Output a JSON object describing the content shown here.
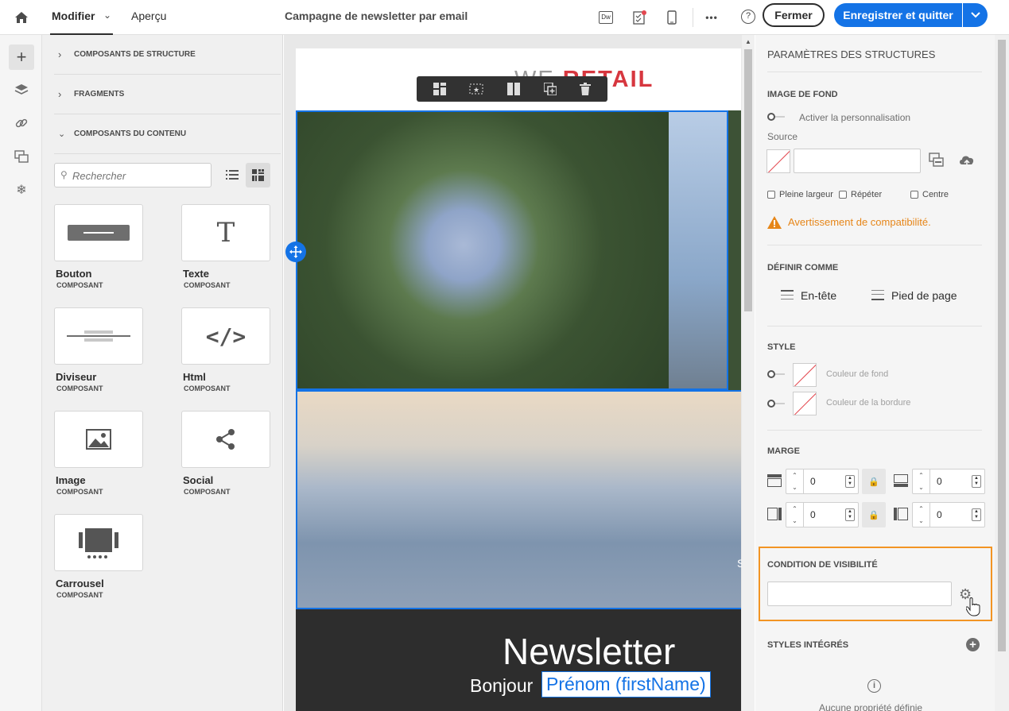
{
  "topbar": {
    "home_icon": "home-icon",
    "tab_edit": "Modifier",
    "tab_preview": "Aperçu",
    "document_title": "Campagne de newsletter par email",
    "dw_label": "Dw",
    "close_label": "Fermer",
    "save_label": "Enregistrer et quitter",
    "more_label": "•••",
    "help_label": "?"
  },
  "left_panel": {
    "sections": [
      {
        "label": "COMPOSANTS DE STRUCTURE"
      },
      {
        "label": "FRAGMENTS"
      },
      {
        "label": "COMPOSANTS DU CONTENU"
      }
    ],
    "search_placeholder": "Rechercher",
    "components": [
      {
        "title": "Bouton",
        "subtitle": "COMPOSANT"
      },
      {
        "title": "Texte",
        "subtitle": "COMPOSANT"
      },
      {
        "title": "Diviseur",
        "subtitle": "COMPOSANT"
      },
      {
        "title": "Html",
        "subtitle": "COMPOSANT"
      },
      {
        "title": "Image",
        "subtitle": "COMPOSANT"
      },
      {
        "title": "Social",
        "subtitle": "COMPOSANT"
      },
      {
        "title": "Carrousel",
        "subtitle": "COMPOSANT"
      }
    ],
    "text_glyph": "T",
    "html_glyph": "</>"
  },
  "canvas": {
    "logo_we": "WE",
    "logo_retail": "RETAIL",
    "newsletter_title": "Newsletter",
    "greeting": "Bonjour",
    "personalization_field": "Prénom (firstName)",
    "cut_letter": "S"
  },
  "right_panel": {
    "title": "PARAMÈTRES DES STRUCTURES",
    "bg_image_heading": "IMAGE DE FOND",
    "enable_personalization": "Activer la personnalisation",
    "source_label": "Source",
    "full_width": "Pleine largeur",
    "repeat": "Répéter",
    "center": "Centre",
    "compat_warning": "Avertissement de compatibilité.",
    "define_as_heading": "DÉFINIR COMME",
    "header_label": "En-tête",
    "footer_label": "Pied de page",
    "style_heading": "STYLE",
    "bg_color_label": "Couleur de fond",
    "border_color_label": "Couleur de la bordure",
    "margin_heading": "MARGE",
    "margin_top": "0",
    "margin_bottom": "0",
    "margin_left": "0",
    "margin_right": "0",
    "visibility_heading": "CONDITION DE VISIBILITÉ",
    "inline_styles_heading": "STYLES INTÉGRÉS",
    "no_property": "Aucune propriété définie"
  },
  "colors": {
    "accent": "#1473e6",
    "warning": "#e68619",
    "highlight": "#f29423",
    "brand_red": "#d7373f"
  }
}
